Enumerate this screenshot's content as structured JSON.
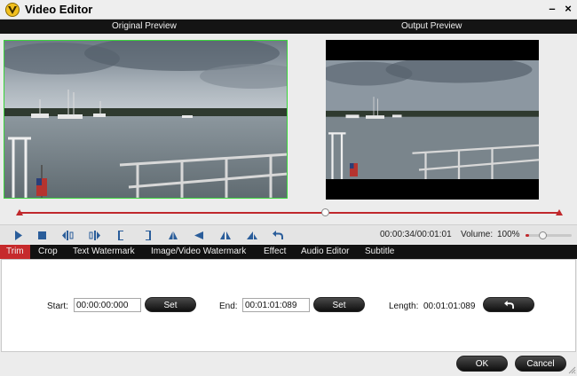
{
  "window": {
    "title": "Video Editor",
    "minimize_glyph": "–",
    "close_glyph": "×"
  },
  "preview": {
    "original_label": "Original Preview",
    "output_label": "Output Preview"
  },
  "timeline": {
    "position_fraction": 0.567
  },
  "toolbar": {
    "buttons": [
      "play-icon",
      "stop-icon",
      "step-back-icon",
      "step-forward-icon",
      "mark-in-icon",
      "mark-out-icon",
      "flip-vertical-icon",
      "rotate-left-icon",
      "flip-horizontal-icon",
      "rotate-right-icon",
      "undo-icon"
    ],
    "time": "00:00:34/00:01:01",
    "volume_label": "Volume:",
    "volume_value": "100%",
    "volume_fraction": 1.0
  },
  "tabs": [
    {
      "label": "Trim",
      "active": true
    },
    {
      "label": "Crop",
      "active": false
    },
    {
      "label": "Text Watermark",
      "active": false
    },
    {
      "label": "Image/Video Watermark",
      "active": false
    },
    {
      "label": "Effect",
      "active": false
    },
    {
      "label": "Audio Editor",
      "active": false
    },
    {
      "label": "Subtitle",
      "active": false
    }
  ],
  "trim": {
    "start_label": "Start:",
    "start_value": "00:00:00:000",
    "set_label": "Set",
    "end_label": "End:",
    "end_value": "00:01:01:089",
    "length_label": "Length:",
    "length_value": "00:01:01:089"
  },
  "footer": {
    "ok_label": "OK",
    "cancel_label": "Cancel"
  },
  "colors": {
    "accent": "#c62a2c",
    "header_bg": "#141414",
    "crop_border": "#39d53b"
  }
}
